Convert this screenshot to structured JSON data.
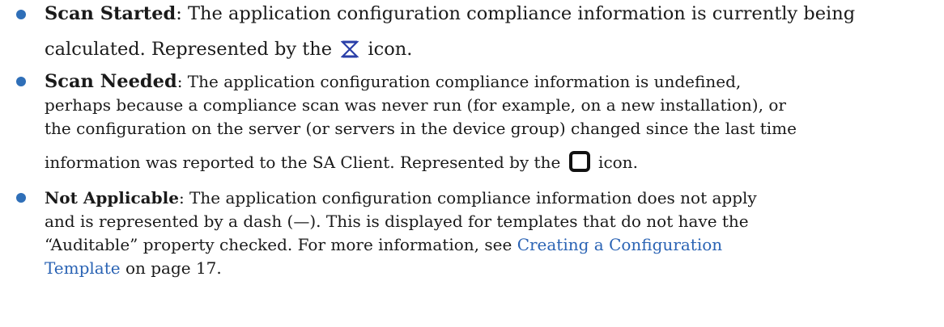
{
  "items": [
    {
      "term": "Scan Started",
      "lines": [
        ": The application configuration compliance information is currently being",
        "calculated. Represented by the"
      ],
      "tail": "icon.",
      "icon": "hourglass-icon"
    },
    {
      "term": "Scan Needed",
      "lines": [
        ": The application configuration compliance information is undefined,",
        "perhaps because a compliance scan was never run (for example, on a new installation), or",
        "the configuration on the server (or servers in the device group) changed since the last time",
        "information was reported to the SA Client. Represented by the"
      ],
      "tail": "icon.",
      "icon": "rounded-square-icon"
    },
    {
      "term": "Not Applicable",
      "lines": [
        ": The application configuration compliance information does not apply",
        "and is represented by a dash (—). This is displayed for templates that do not have the",
        "“Auditable” property checked. For more information, see"
      ],
      "link_part1": "Creating a Configuration",
      "link_part2": "Template",
      "after_link": "on page 17."
    }
  ],
  "colors": {
    "bullet": "#2f6fb8",
    "link": "#2a63b4",
    "text": "#1a1a1a"
  }
}
